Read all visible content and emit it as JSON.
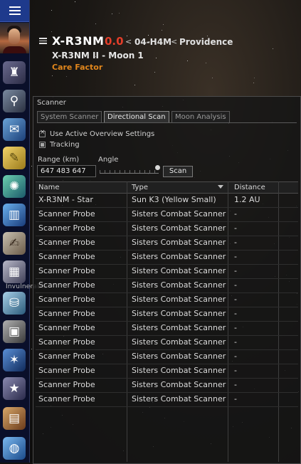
{
  "header": {
    "system": "X-R3NM",
    "security": "0.0",
    "constellation": "04-H4M",
    "region": "Providence",
    "location": "X-R3NM II - Moon 1",
    "owner": "Care Factor",
    "separator": "<"
  },
  "sidebar": {
    "inventory_label": "Invulnerable"
  },
  "scanner": {
    "title": "Scanner",
    "tabs": [
      "System Scanner",
      "Directional Scan",
      "Moon Analysis"
    ],
    "active_tab": "Directional Scan",
    "options": {
      "use_overview": "Use Active Overview Settings",
      "tracking": "Tracking"
    },
    "range_label": "Range (km)",
    "range_value": "647 483 647",
    "angle_label": "Angle",
    "scan_label": "Scan",
    "columns": [
      "Name",
      "Type",
      "Distance"
    ],
    "rows": [
      {
        "name": "X-R3NM - Star",
        "type": "Sun K3 (Yellow Small)",
        "distance": "1.2 AU"
      },
      {
        "name": "Scanner Probe",
        "type": "Sisters Combat Scanner",
        "distance": "-"
      },
      {
        "name": "Scanner Probe",
        "type": "Sisters Combat Scanner",
        "distance": "-"
      },
      {
        "name": "Scanner Probe",
        "type": "Sisters Combat Scanner",
        "distance": "-"
      },
      {
        "name": "Scanner Probe",
        "type": "Sisters Combat Scanner",
        "distance": "-"
      },
      {
        "name": "Scanner Probe",
        "type": "Sisters Combat Scanner",
        "distance": "-"
      },
      {
        "name": "Scanner Probe",
        "type": "Sisters Combat Scanner",
        "distance": "-"
      },
      {
        "name": "Scanner Probe",
        "type": "Sisters Combat Scanner",
        "distance": "-"
      },
      {
        "name": "Scanner Probe",
        "type": "Sisters Combat Scanner",
        "distance": "-"
      },
      {
        "name": "Scanner Probe",
        "type": "Sisters Combat Scanner",
        "distance": "-"
      },
      {
        "name": "Scanner Probe",
        "type": "Sisters Combat Scanner",
        "distance": "-"
      },
      {
        "name": "Scanner Probe",
        "type": "Sisters Combat Scanner",
        "distance": "-"
      },
      {
        "name": "Scanner Probe",
        "type": "Sisters Combat Scanner",
        "distance": "-"
      },
      {
        "name": "Scanner Probe",
        "type": "Sisters Combat Scanner",
        "distance": "-"
      },
      {
        "name": "Scanner Probe",
        "type": "Sisters Combat Scanner",
        "distance": "-"
      }
    ]
  },
  "colors": {
    "security_red": "#e33e2a",
    "owner_orange": "#e0861c",
    "menu_blue": "#1e3a8c"
  }
}
